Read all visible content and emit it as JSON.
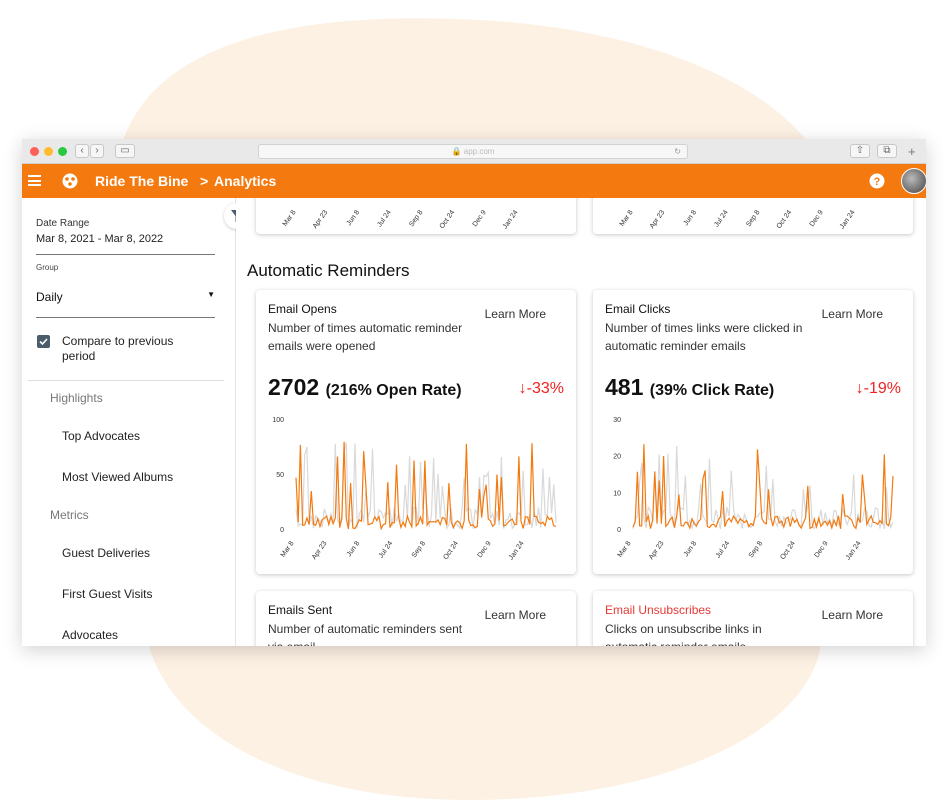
{
  "browser": {
    "url": "app.com"
  },
  "appbar": {
    "brand": "Ride The Bine",
    "separator": ">",
    "page": "Analytics",
    "color": "#f47a10"
  },
  "sidebar": {
    "date_range_label": "Date Range",
    "date_range_value": "Mar 8, 2021 - Mar 8, 2022",
    "group_label": "Group",
    "group_value": "Daily",
    "compare_label": "Compare to previous period",
    "compare_checked": true,
    "sections": [
      {
        "heading": "Highlights",
        "items": [
          "Top Advocates",
          "Most Viewed Albums"
        ]
      },
      {
        "heading": "Metrics",
        "items": [
          "Guest Deliveries",
          "First Guest Visits",
          "Advocates"
        ]
      }
    ]
  },
  "main": {
    "section_title": "Automatic Reminders",
    "x_ticks": [
      "Mar 8",
      "Apr 23",
      "Jun 8",
      "Jul 24",
      "Sep 8",
      "Oct 24",
      "Dec 9",
      "Jan 24"
    ],
    "cards": [
      {
        "title": "Email Opens",
        "description": "Number of times automatic reminder emails were opened",
        "learn_more": "Learn More",
        "value": "2702",
        "rate": "(216% Open Rate)",
        "delta": "-33%",
        "y_ticks": [
          "100",
          "50",
          "0"
        ]
      },
      {
        "title": "Email Clicks",
        "description": "Number of times links were clicked in automatic reminder emails",
        "learn_more": "Learn More",
        "value": "481",
        "rate": "(39% Click Rate)",
        "delta": "-19%",
        "y_ticks": [
          "30",
          "20",
          "10",
          "0"
        ]
      },
      {
        "title": "Emails Sent",
        "description": "Number of automatic reminders sent via email",
        "learn_more": "Learn More"
      },
      {
        "title": "Email Unsubscribes",
        "description": "Clicks on unsubscribe links in automatic reminder emails",
        "learn_more": "Learn More",
        "title_color": "#e53935"
      }
    ]
  }
}
